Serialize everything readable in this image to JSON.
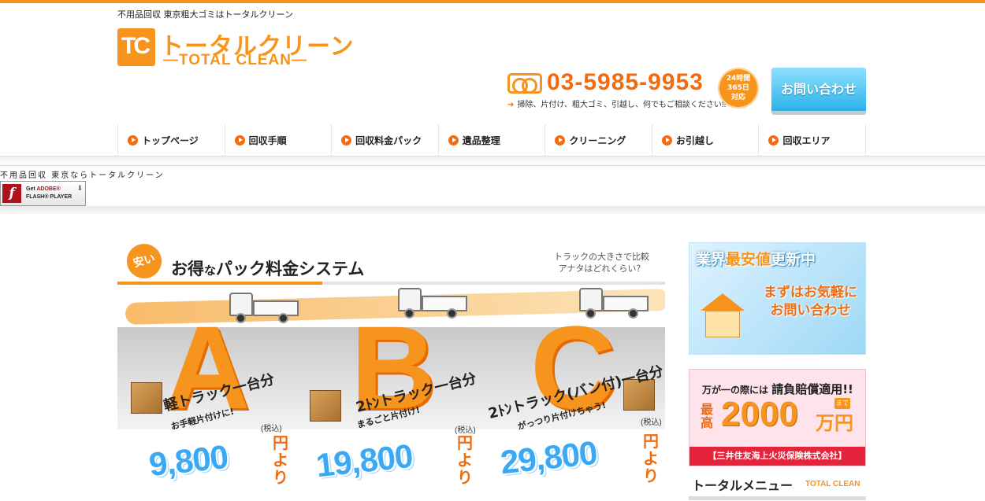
{
  "header": {
    "tagline": "不用品回収 東京粗大ゴミはトータルクリーン",
    "logo_mark": "TC",
    "logo_jp": "トータルクリーン",
    "logo_en": "—TOTAL CLEAN—",
    "phone": "03-5985-9953",
    "phone_sub": "掃除、片付け、粗大ゴミ、引越し、何でもご相談ください!!",
    "badge": [
      "24時間",
      "365日",
      "対応"
    ],
    "contact_button": "お問い合わせ"
  },
  "nav": {
    "items": [
      {
        "label": "トップページ"
      },
      {
        "label": "回収手順"
      },
      {
        "label": "回収料金パック"
      },
      {
        "label": "遺品整理"
      },
      {
        "label": "クリーニング"
      },
      {
        "label": "お引越し"
      },
      {
        "label": "回収エリア"
      }
    ]
  },
  "flash": {
    "title": "不用品回収 東京ならトータルクリーン",
    "get": "Get",
    "adobe": "ADOBE®",
    "player": "FLASH® PLAYER"
  },
  "pack": {
    "badge": "安い",
    "title_pre": "お得",
    "title_na": "な",
    "title_post": "パック料金システム",
    "note_line1": "トラックの大きさで比較",
    "note_line2": "アナタはどれくらい？",
    "plans": [
      {
        "letter": "A",
        "label": "軽トラック一台分",
        "sub": "お手軽片付けに!",
        "tax": "(税込)",
        "price": "9,800",
        "yen": "円",
        "yori": "より"
      },
      {
        "letter": "B",
        "label": "2ﾄﾝトラック一台分",
        "sub": "まるごと片付け!",
        "tax": "(税込)",
        "price": "19,800",
        "yen": "円",
        "yori": "より"
      },
      {
        "letter": "C",
        "label": "2ﾄﾝトラック(バン付)一台分",
        "sub": "がっつり片付けちゃう!",
        "tax": "(税込)",
        "price": "29,800",
        "yen": "円",
        "yori": "より"
      }
    ]
  },
  "side": {
    "saiyasu_pre": "業界",
    "saiyasu_hl": "最安値",
    "saiyasu_post": "更新中",
    "saiyasu_line1": "まずはお気軽に",
    "saiyasu_line2": "お問い合わせ",
    "insure_line1_pre": "万が一の際には",
    "insure_line1_bold": "請負賠償適用!!",
    "insure_max": "最高",
    "insure_amount": "2000",
    "insure_unit": "万円",
    "insure_made": "まで",
    "insure_company": "【三井住友海上火災保険株式会社】",
    "menu_jp": "トータルメニュー",
    "menu_en": "TOTAL CLEAN"
  }
}
